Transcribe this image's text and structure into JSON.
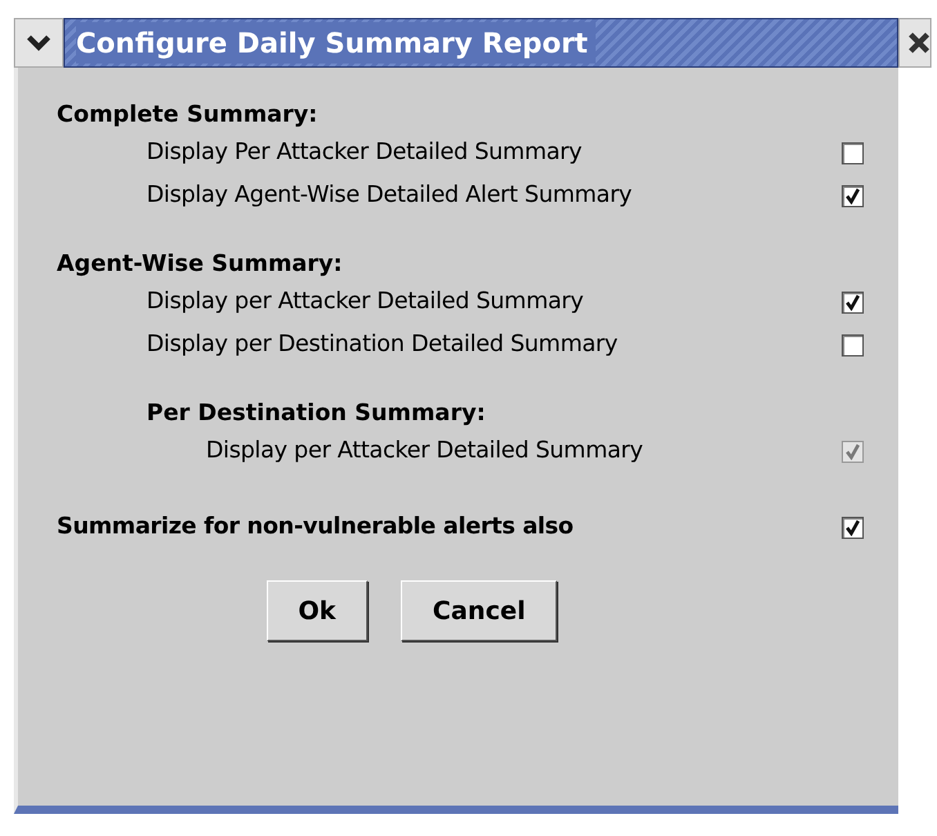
{
  "window": {
    "title": "Configure Daily Summary Report"
  },
  "sections": [
    {
      "heading": "Complete Summary:",
      "items": [
        {
          "label": "Display Per Attacker Detailed Summary",
          "checked": false,
          "disabled": false
        },
        {
          "label": "Display Agent-Wise Detailed Alert Summary",
          "checked": true,
          "disabled": false
        }
      ]
    },
    {
      "heading": "Agent-Wise Summary:",
      "items": [
        {
          "label": "Display per Attacker Detailed Summary",
          "checked": true,
          "disabled": false
        },
        {
          "label": "Display per Destination Detailed Summary",
          "checked": false,
          "disabled": false
        }
      ],
      "children": [
        {
          "heading": "Per Destination Summary:",
          "items": [
            {
              "label": "Display per Attacker Detailed Summary",
              "checked": true,
              "disabled": true
            }
          ]
        }
      ]
    }
  ],
  "option": {
    "label": "Summarize for non-vulnerable alerts also",
    "checked": true,
    "disabled": false
  },
  "buttons": [
    "Ok",
    "Cancel"
  ]
}
